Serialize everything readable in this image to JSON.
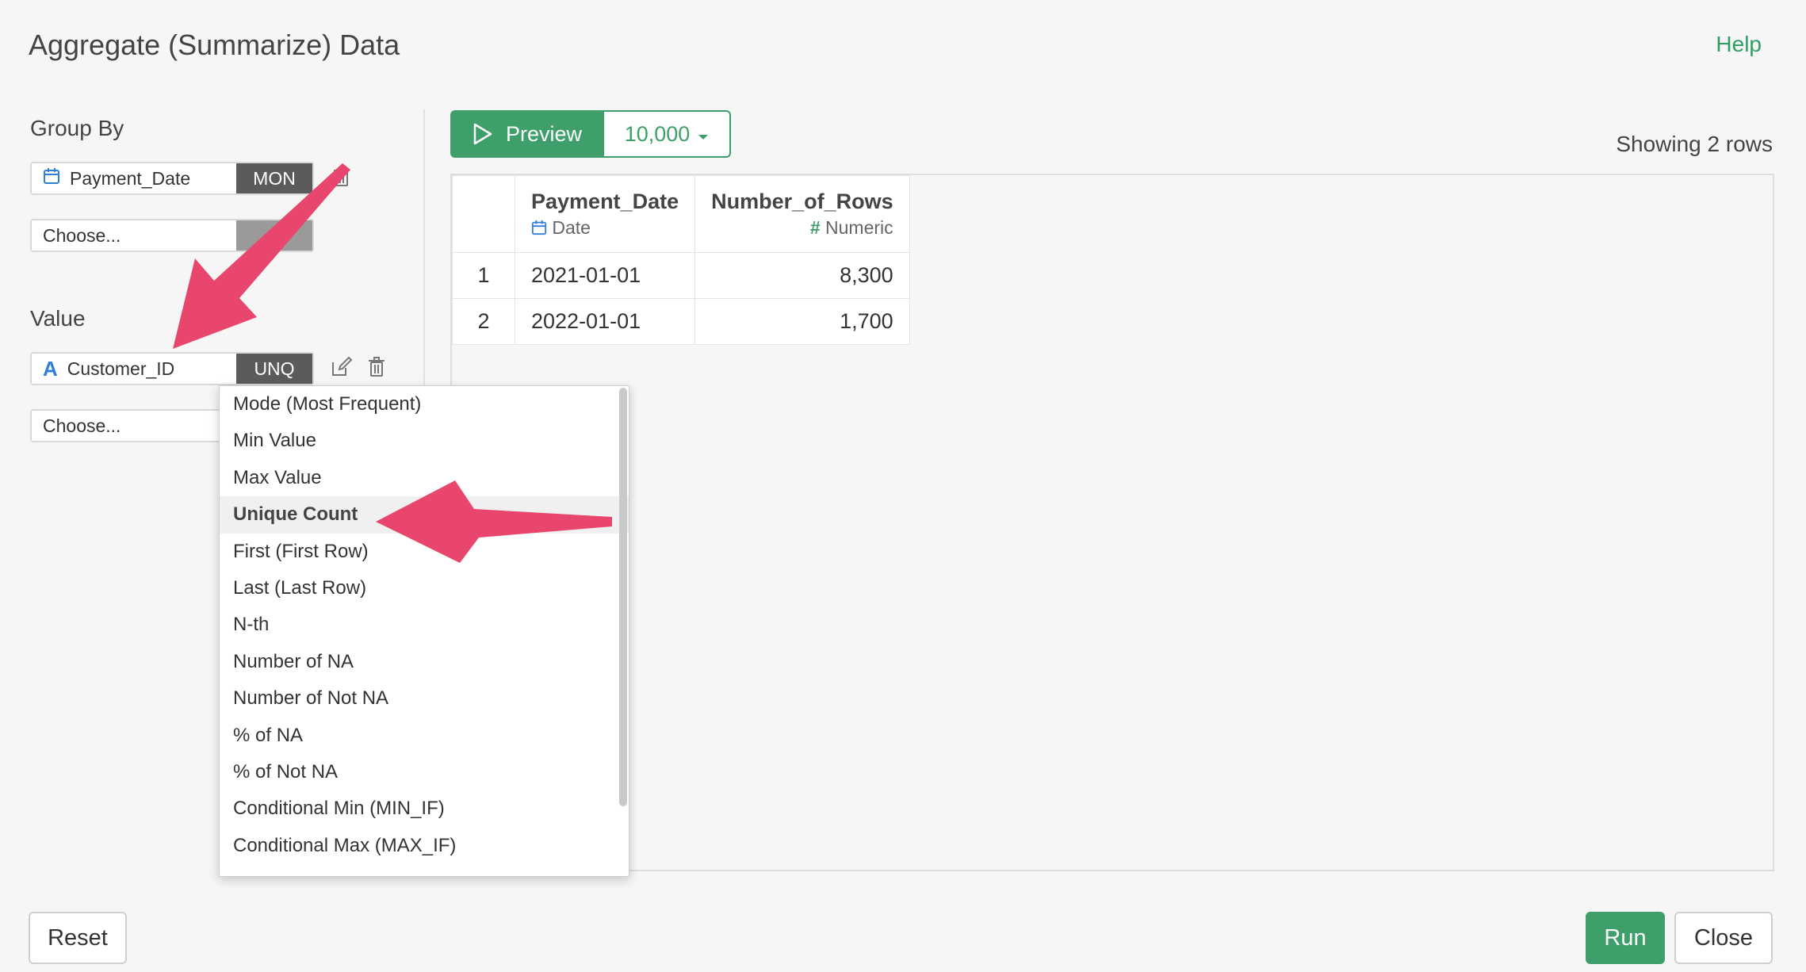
{
  "dialog": {
    "title": "Aggregate (Summarize) Data",
    "help_label": "Help"
  },
  "group_by": {
    "label": "Group By",
    "field": {
      "name": "Payment_Date",
      "tag": "MON",
      "icon": "calendar-icon"
    },
    "choose_placeholder": "Choose..."
  },
  "value": {
    "label": "Value",
    "field": {
      "name": "Customer_ID",
      "tag": "UNQ",
      "icon": "character-type-icon",
      "icon_glyph": "A"
    },
    "choose_placeholder": "Choose..."
  },
  "preview": {
    "button_label": "Preview",
    "rows_limit": "10,000",
    "showing": "Showing 2 rows"
  },
  "grid": {
    "columns": [
      {
        "name": "Payment_Date",
        "type": "Date",
        "type_icon": "calendar-icon"
      },
      {
        "name": "Number_of_Rows",
        "type": "Numeric",
        "type_icon": "hash-icon",
        "type_glyph": "#"
      }
    ],
    "rows": [
      {
        "num": "1",
        "date": "2021-01-01",
        "count": "8,300"
      },
      {
        "num": "2",
        "date": "2022-01-01",
        "count": "1,700"
      }
    ]
  },
  "dropdown": {
    "selected": "Unique Count",
    "items": [
      "Mode (Most Frequent)",
      "Min Value",
      "Max Value",
      "Unique Count",
      "First (First Row)",
      "Last (Last Row)",
      "N-th",
      "Number of NA",
      "Number of Not NA",
      "% of NA",
      "% of Not NA",
      "Conditional Min (MIN_IF)",
      "Conditional Max (MAX_IF)"
    ]
  },
  "footer": {
    "reset_label": "Reset",
    "run_label": "Run",
    "close_label": "Close"
  },
  "colors": {
    "accent": "#3e9f6a",
    "annotation_arrow": "#e8466d",
    "tag_bg": "#5b5b5b"
  }
}
